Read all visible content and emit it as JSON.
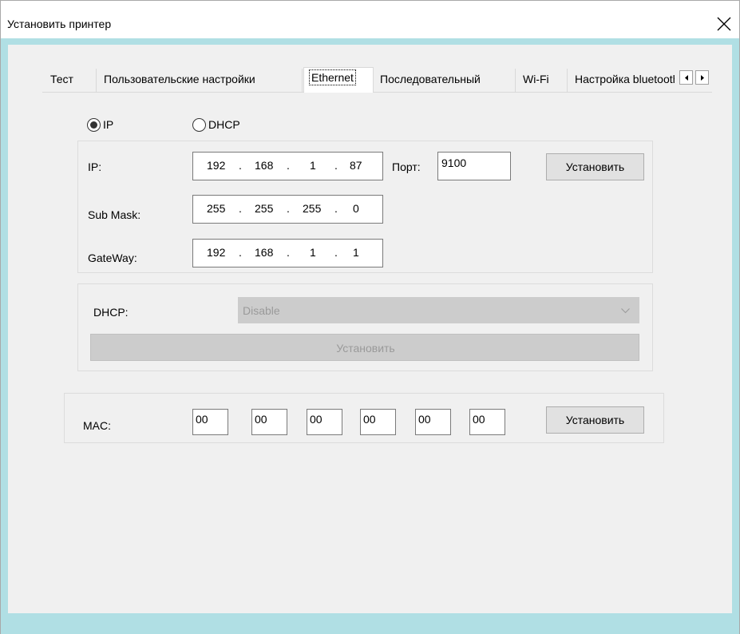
{
  "window": {
    "title": "Установить принтер",
    "close_icon": "close-icon"
  },
  "tabs": [
    {
      "label": "Тест"
    },
    {
      "label": "Пользовательские настройки"
    },
    {
      "label": "Ethernet",
      "active": true
    },
    {
      "label": "Последовательный"
    },
    {
      "label": "Wi-Fi"
    },
    {
      "label": "Настройка bluetooth"
    }
  ],
  "mode": {
    "ip_label": "IP",
    "dhcp_label": "DHCP",
    "selected": "IP"
  },
  "network": {
    "ip_label": "IP:",
    "ip_octets": [
      "192",
      "168",
      "1",
      "87"
    ],
    "port_label": "Порт:",
    "port_value": "9100",
    "set_button": "Установить",
    "mask_label": "Sub Mask:",
    "mask_octets": [
      "255",
      "255",
      "255",
      "0"
    ],
    "gateway_label": "GateWay:",
    "gateway_octets": [
      "192",
      "168",
      "1",
      "1"
    ],
    "ip_separator": "."
  },
  "dhcp": {
    "label": "DHCP:",
    "selected_option": "Disable",
    "set_button": "Установить"
  },
  "mac": {
    "label": "MAC:",
    "fields": [
      "00",
      "00",
      "00",
      "00",
      "00",
      "00"
    ],
    "set_button": "Установить"
  },
  "colors": {
    "frame_background": "#b0dfe4",
    "panel_background": "#f0f0f0",
    "button_face": "#e1e1e1",
    "disabled_face": "#cccccc"
  }
}
